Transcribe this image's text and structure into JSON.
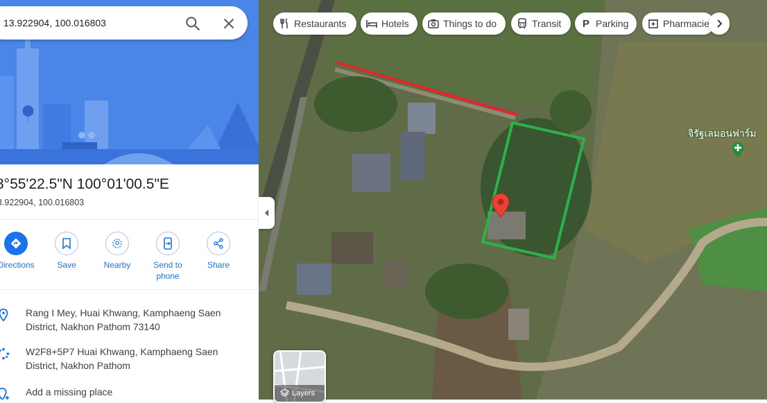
{
  "search": {
    "value": "13.922904, 100.016803",
    "search_icon": "search-icon",
    "clear_icon": "close-icon"
  },
  "place": {
    "title": "3°55'22.5\"N 100°01'00.5\"E",
    "subtitle": "3.922904, 100.016803"
  },
  "actions": [
    {
      "label": "Directions",
      "icon": "directions-icon"
    },
    {
      "label": "Save",
      "icon": "bookmark-icon"
    },
    {
      "label": "Nearby",
      "icon": "nearby-icon"
    },
    {
      "label": "Send to phone",
      "icon": "send-to-phone-icon"
    },
    {
      "label": "Share",
      "icon": "share-icon"
    }
  ],
  "info": [
    {
      "text": "Rang I Mey, Huai Khwang, Kamphaeng Saen District, Nakhon Pathom 73140",
      "icon": "location-pin-icon"
    },
    {
      "text": "W2F8+5P7 Huai Khwang, Kamphaeng Saen District, Nakhon Pathom",
      "icon": "plus-code-icon"
    },
    {
      "text": "Add a missing place",
      "icon": "add-place-icon"
    }
  ],
  "chips": [
    {
      "label": "Restaurants",
      "icon": "fork-knife-icon"
    },
    {
      "label": "Hotels",
      "icon": "bed-icon"
    },
    {
      "label": "Things to do",
      "icon": "camera-icon"
    },
    {
      "label": "Transit",
      "icon": "bus-icon"
    },
    {
      "label": "Parking",
      "icon": "parking-icon"
    },
    {
      "label": "Pharmacies",
      "icon": "pharmacy-icon"
    }
  ],
  "map": {
    "poi_label": "จิรัฐเลมอนฟาร์ม",
    "layers_label": "Layers",
    "annotation_colors": {
      "red_line": "#e8232a",
      "green_box": "#2bb24a"
    }
  },
  "colors": {
    "accent": "#1a73e8",
    "hero_bg": "#4a86e8"
  }
}
